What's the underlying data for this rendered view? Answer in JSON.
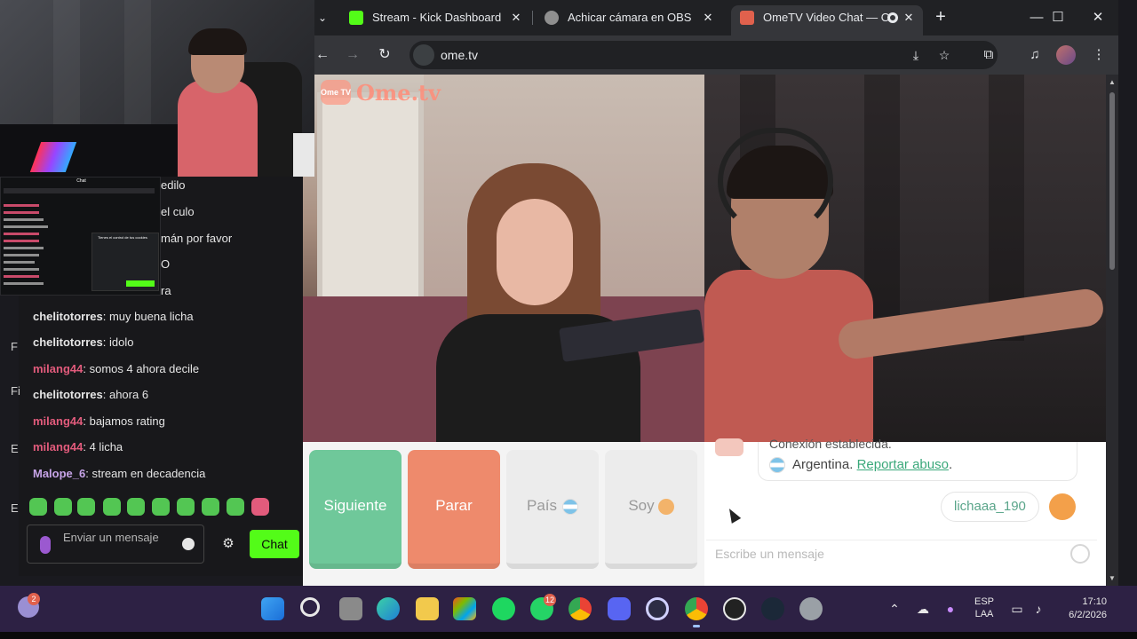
{
  "browser": {
    "tabs": [
      {
        "title": "Stream - Kick Dashboard",
        "active": false,
        "favicon_color": "#53fc18"
      },
      {
        "title": "Achicar cámara en OBS",
        "active": false,
        "favicon_color": "#8f8f8f"
      },
      {
        "title": "OmeTV Video Chat — O",
        "active": true,
        "favicon_color": "#e0614d"
      }
    ],
    "new_tab": "+",
    "url": "ome.tv",
    "window_controls": {
      "minimize": "—",
      "maximize": "☐",
      "close": "✕"
    }
  },
  "ometv": {
    "logo_badge": "Ome TV",
    "logo_text": "Ome.tv",
    "buttons": {
      "next": "Siguiente",
      "stop": "Parar",
      "country": "País",
      "gender": "Soy"
    },
    "chat": {
      "system_line1": "Conexión establecida.",
      "system_country": "Argentina.",
      "report_link": "Reportar abuso",
      "report_suffix": ".",
      "partner_username": "lichaaa_190",
      "input_placeholder": "Escribe un mensaje"
    }
  },
  "kick_chat": {
    "partial_lines": [
      "edilo",
      "el culo",
      "mán por favor",
      "O",
      "ra"
    ],
    "messages": [
      {
        "user": "chelitotorres",
        "text": ": muy buena licha",
        "color": "#e5e5e5"
      },
      {
        "user": "chelitotorres",
        "text": ": idolo",
        "color": "#e5e5e5"
      },
      {
        "user": "milang44",
        "text": ": somos 4 ahora decile",
        "color": "#e25b7c"
      },
      {
        "user": "chelitotorres",
        "text": ": ahora 6",
        "color": "#e5e5e5"
      },
      {
        "user": "milang44",
        "text": ": bajamos rating",
        "color": "#e25b7c"
      },
      {
        "user": "milang44",
        "text": ": 4 licha",
        "color": "#e25b7c"
      },
      {
        "user": "Malope_6",
        "text": ": stream en decadencia",
        "color": "#c7a4e8"
      }
    ],
    "input_placeholder": "Enviar un mensaje",
    "send_label": "Chat"
  },
  "mini_chat": {
    "title": "Chat",
    "popup_title": "Tienes el control de tus cookies"
  },
  "left_strip_letters": [
    "F",
    "Fi",
    "E",
    "E"
  ],
  "taskbar": {
    "weather_badge": "2",
    "whatsapp_badge": "12",
    "lang_line1": "ESP",
    "lang_line2": "LAA",
    "time": "17:10",
    "date": "6/2/2026"
  }
}
